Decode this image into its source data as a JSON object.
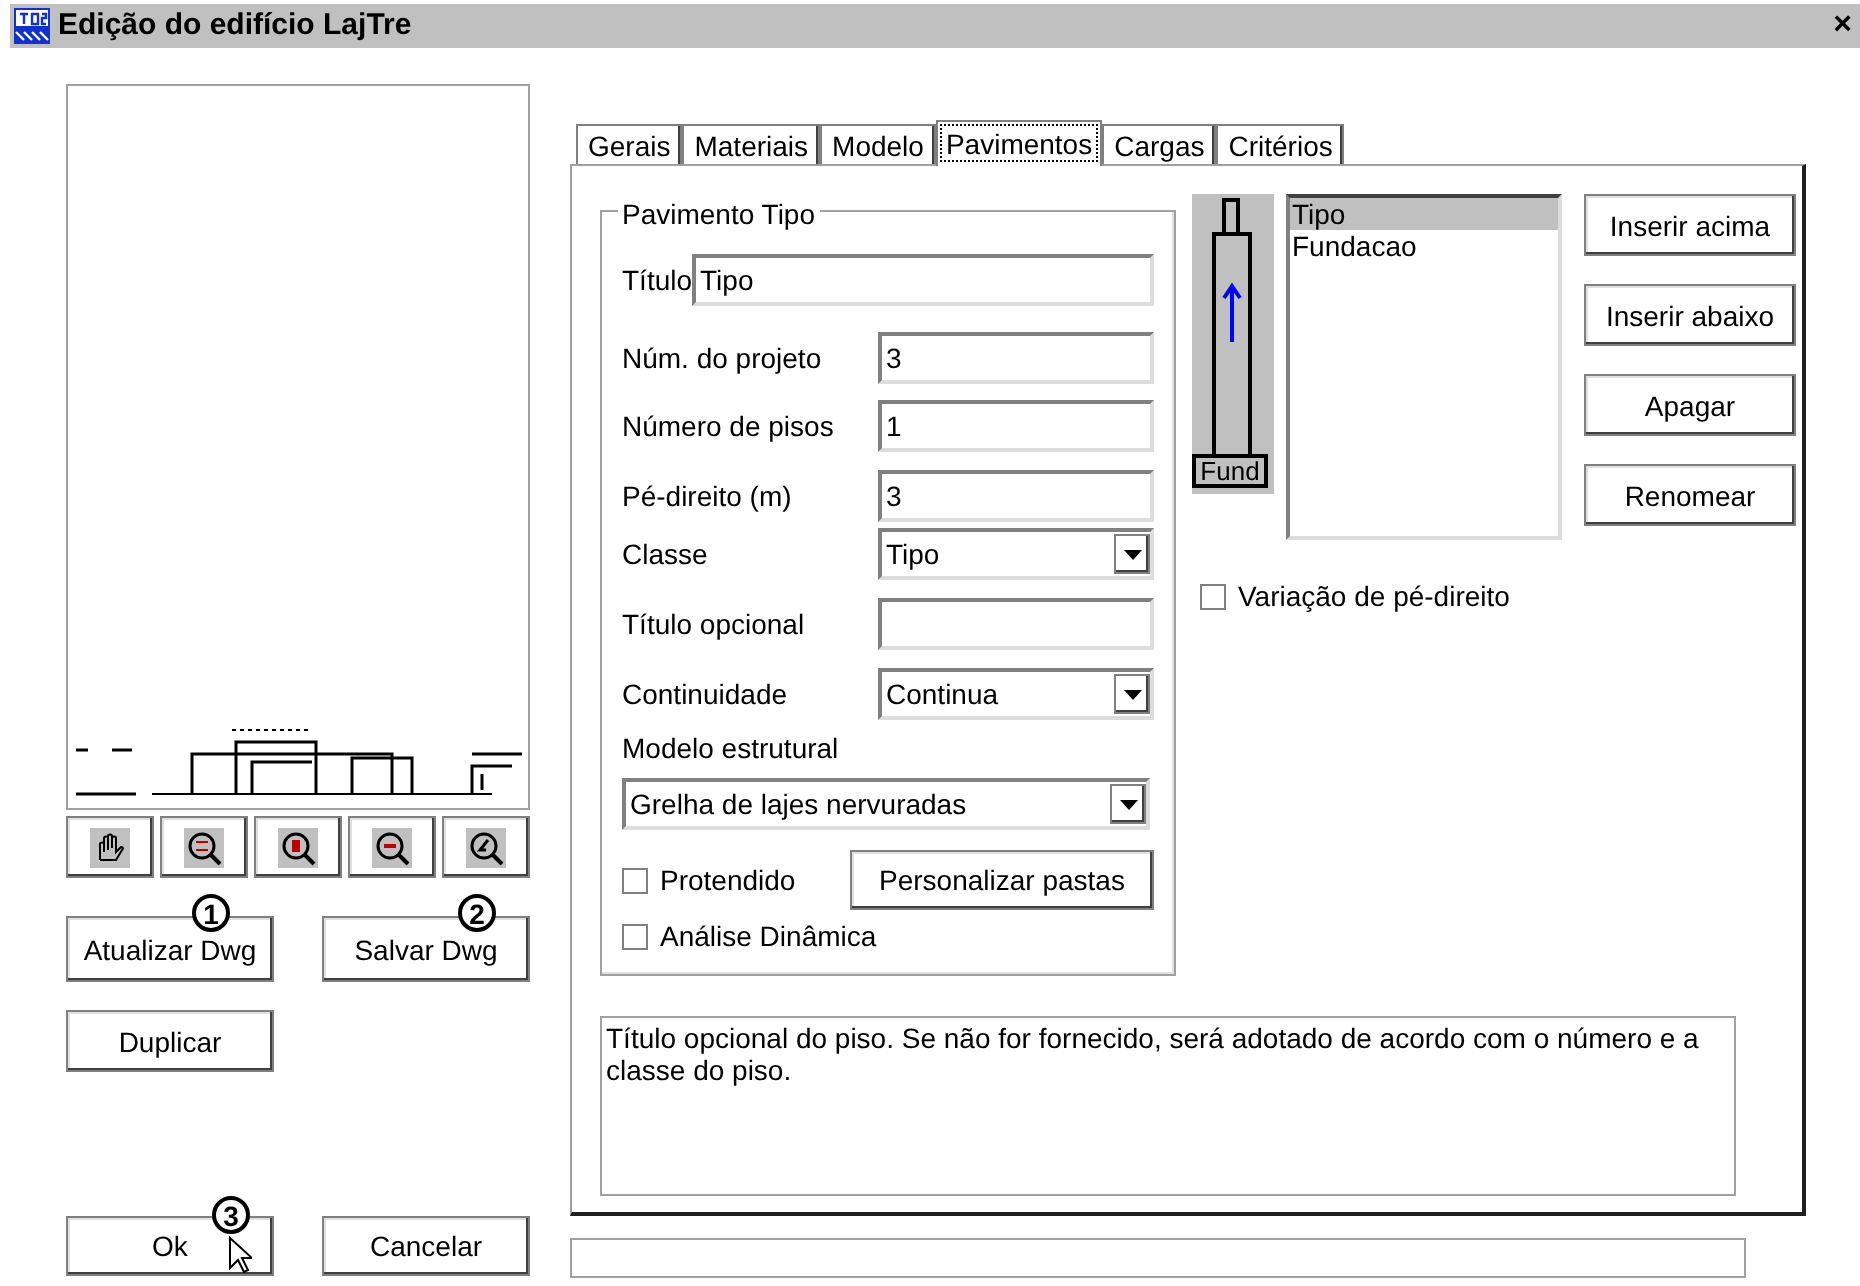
{
  "window": {
    "title": "Edição do edifício LajTre",
    "close": "×"
  },
  "left_panel": {
    "buttons": [
      {
        "label": "Atualizar Dwg",
        "callout": "1"
      },
      {
        "label": "Salvar Dwg",
        "callout": "2"
      },
      {
        "label": "Duplicar"
      }
    ],
    "dialog_buttons": [
      {
        "label": "Ok",
        "callout": "3"
      },
      {
        "label": "Cancelar"
      }
    ]
  },
  "tabs": [
    {
      "label": "Gerais",
      "selected": false
    },
    {
      "label": "Materiais",
      "selected": false
    },
    {
      "label": "Modelo",
      "selected": false
    },
    {
      "label": "Pavimentos",
      "selected": true
    },
    {
      "label": "Cargas",
      "selected": false
    },
    {
      "label": "Critérios",
      "selected": false
    }
  ],
  "group": {
    "title": "Pavimento Tipo",
    "rows": [
      {
        "kind": "wide_text",
        "label": "Título",
        "value": "Tipo"
      },
      {
        "kind": "text",
        "label": "Núm. do projeto",
        "value": "3"
      },
      {
        "kind": "text",
        "label": "Número de pisos",
        "value": "1"
      },
      {
        "kind": "text",
        "label": "Pé-direito (m)",
        "value": "3"
      },
      {
        "kind": "combo",
        "label": "Classe",
        "value": "Tipo"
      },
      {
        "kind": "text",
        "label": "Título opcional"
      },
      {
        "kind": "combo",
        "label": "Continuidade",
        "value": "Continua"
      },
      {
        "kind": "stacked_combo",
        "label": "Modelo estrutural",
        "value": "Grelha de lajes nervuradas"
      },
      {
        "kind": "checkbox_button",
        "label": "Protendido",
        "checked": false,
        "button": "Personalizar pastas"
      },
      {
        "kind": "checkbox",
        "label": "Análise Dinâmica",
        "checked": false
      }
    ]
  },
  "floor_diagram": {
    "label": "Fund"
  },
  "floors": [
    {
      "name": "Tipo",
      "selected": true
    },
    {
      "name": "Fundacao",
      "selected": false
    }
  ],
  "floor_buttons": [
    "Inserir acima",
    "Inserir abaixo",
    "Apagar",
    "Renomear"
  ],
  "height_variation": {
    "label": "Variação de pé-direito",
    "checked": false
  },
  "description": "Título opcional do piso. Se não for fornecido, será adotado de acordo com o número e a classe do piso."
}
